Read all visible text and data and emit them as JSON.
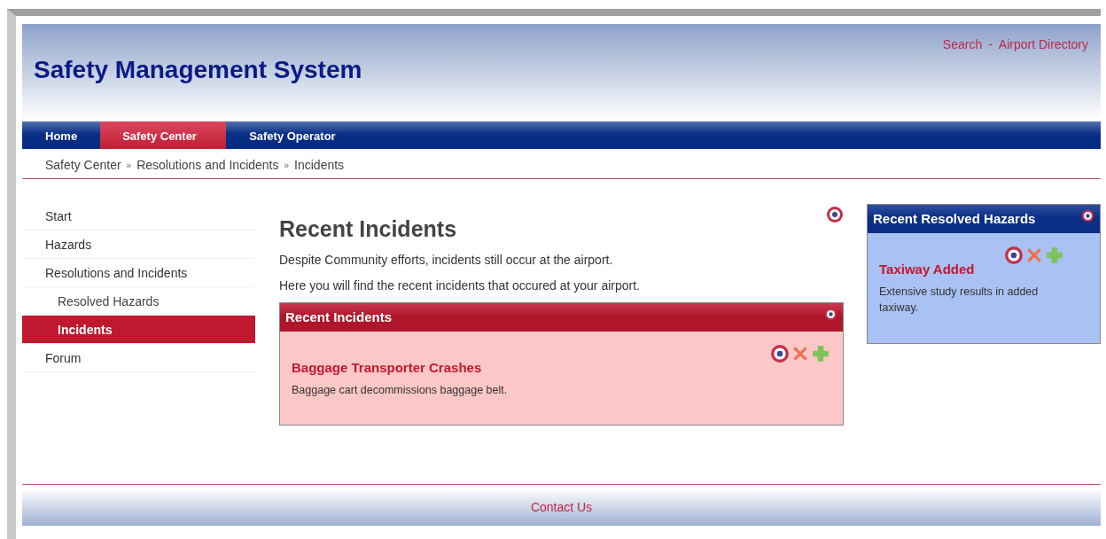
{
  "header": {
    "title": "Safety Management System",
    "links": [
      "Search",
      "Airport Directory"
    ],
    "separator": "-"
  },
  "nav": [
    {
      "label": "Home",
      "selected": false
    },
    {
      "label": "Safety Center",
      "selected": true
    },
    {
      "label": "Safety Operator",
      "selected": false
    }
  ],
  "breadcrumb": {
    "items": [
      "Safety Center",
      "Resolutions and Incidents",
      "Incidents"
    ],
    "separator": "»"
  },
  "sidebar": {
    "items": [
      {
        "label": "Start",
        "selected": false
      },
      {
        "label": "Hazards",
        "selected": false
      },
      {
        "label": "Resolutions and Incidents",
        "selected": false,
        "children": [
          {
            "label": "Resolved Hazards",
            "selected": false
          },
          {
            "label": "Incidents",
            "selected": true
          }
        ]
      },
      {
        "label": "Forum",
        "selected": false
      }
    ]
  },
  "main": {
    "heading": "Recent Incidents",
    "paragraphs": [
      "Despite Community efforts, incidents still occur at the airport.",
      "Here you will find the recent incidents that occured at your airport."
    ],
    "panel": {
      "title": "Recent Incidents",
      "kind": "incident",
      "items": [
        {
          "title": "Baggage Transporter Crashes",
          "text": "Baggage cart decommissions baggage belt."
        }
      ]
    }
  },
  "aside": {
    "panel": {
      "title": "Recent Resolved Hazards",
      "kind": "hazard",
      "items": [
        {
          "title": "Taxiway Added",
          "text": "Extensive study results in added taxiway."
        }
      ]
    }
  },
  "footer": {
    "link": "Contact Us"
  }
}
